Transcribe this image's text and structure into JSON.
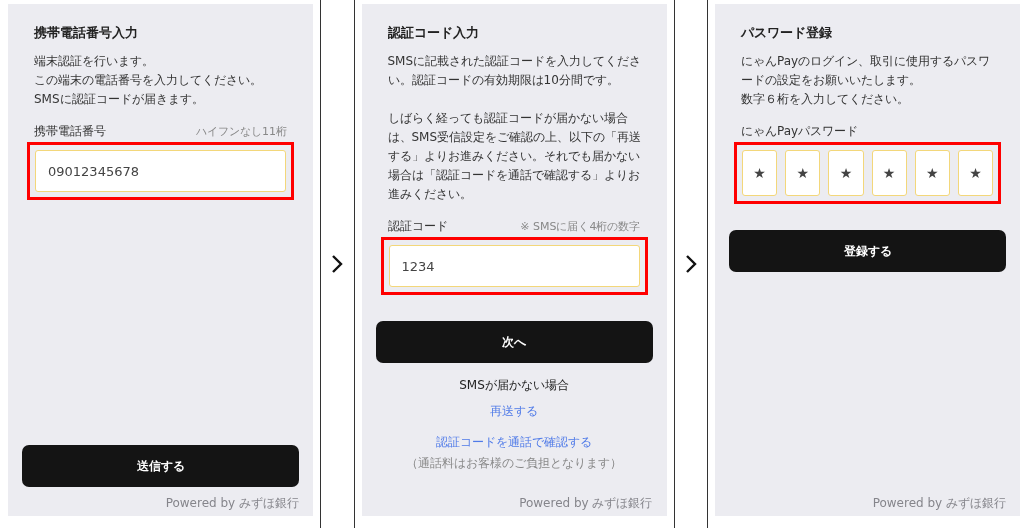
{
  "screens": [
    {
      "kind": "phone",
      "title": "携帯電話番号入力",
      "paragraphs": [
        "端末認証を行います。",
        "この端末の電話番号を入力してください。",
        "SMSに認証コードが届きます。"
      ],
      "field": {
        "kind": "text",
        "label": "携帯電話番号",
        "hint": "ハイフンなし11桁",
        "value": "09012345678",
        "highlighted": true
      },
      "button": {
        "label": "送信する"
      },
      "footer": "Powered by みずほ銀行"
    },
    {
      "kind": "code",
      "title": "認証コード入力",
      "paragraphs": [
        "SMSに記載された認証コードを入力してください。認証コードの有効期限は10分間です。",
        "しばらく経っても認証コードが届かない場合は、SMS受信設定をご確認の上、以下の「再送する」よりお進みください。それでも届かない場合は「認証コードを通話で確認する」よりお進みください。"
      ],
      "field": {
        "kind": "text",
        "label": "認証コード",
        "hint": "※ SMSに届く4桁の数字",
        "value": "1234",
        "highlighted": true
      },
      "button": {
        "label": "次へ"
      },
      "help": {
        "heading": "SMSが届かない場合",
        "links": [
          "再送する",
          "認証コードを通話で確認する"
        ],
        "note": "（通話料はお客様のご負担となります）"
      },
      "footer": "Powered by みずほ銀行"
    },
    {
      "kind": "password",
      "title": "パスワード登録",
      "paragraphs": [
        "にゃんPayのログイン、取引に使用するパスワードの設定をお願いいたします。",
        "数字６桁を入力してください。"
      ],
      "field": {
        "kind": "pin",
        "label": "にゃんPayパスワード",
        "digits": [
          "★",
          "★",
          "★",
          "★",
          "★",
          "★"
        ],
        "highlighted": true
      },
      "button": {
        "label": "登録する"
      },
      "footer": "Powered by みずほ銀行"
    }
  ]
}
